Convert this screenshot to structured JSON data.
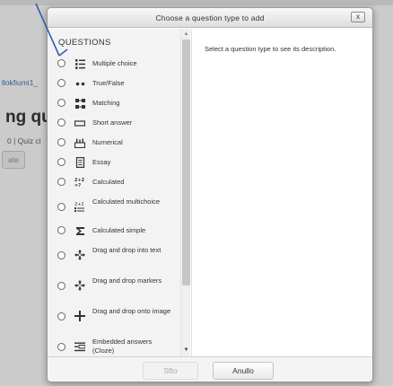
{
  "background": {
    "breadcrumb": "llokfiumi1_",
    "title": "ng qu",
    "meta": "0 | Quiz cl",
    "button_label": "ate"
  },
  "dialog": {
    "title": "Choose a question type to add",
    "close_label": "x",
    "section_heading": "QUESTIONS",
    "description": "Select a question type to see its description.",
    "submit_label": "Sfto",
    "cancel_label": "Anullo"
  },
  "question_types": [
    {
      "label": "Multiple choice",
      "icon": "list-bullets-icon"
    },
    {
      "label": "True/False",
      "icon": "two-dots-icon"
    },
    {
      "label": "Matching",
      "icon": "matching-grid-icon"
    },
    {
      "label": "Short answer",
      "icon": "text-field-icon"
    },
    {
      "label": "Numerical",
      "icon": "numbers-icon"
    },
    {
      "label": "Essay",
      "icon": "document-icon"
    },
    {
      "label": "Calculated",
      "icon": "calculated-icon"
    },
    {
      "label": "Calculated multichoice",
      "icon": "calculated-multichoice-icon"
    },
    {
      "label": "Calculated simple",
      "icon": "calculated-simple-icon"
    },
    {
      "label": "Drag and drop into text",
      "icon": "drag-text-icon"
    },
    {
      "label": "Drag and drop markers",
      "icon": "drag-markers-icon"
    },
    {
      "label": "Drag and drop onto image",
      "icon": "drag-image-icon"
    },
    {
      "label": "Embedded answers (Cloze)",
      "icon": "cloze-icon"
    }
  ]
}
